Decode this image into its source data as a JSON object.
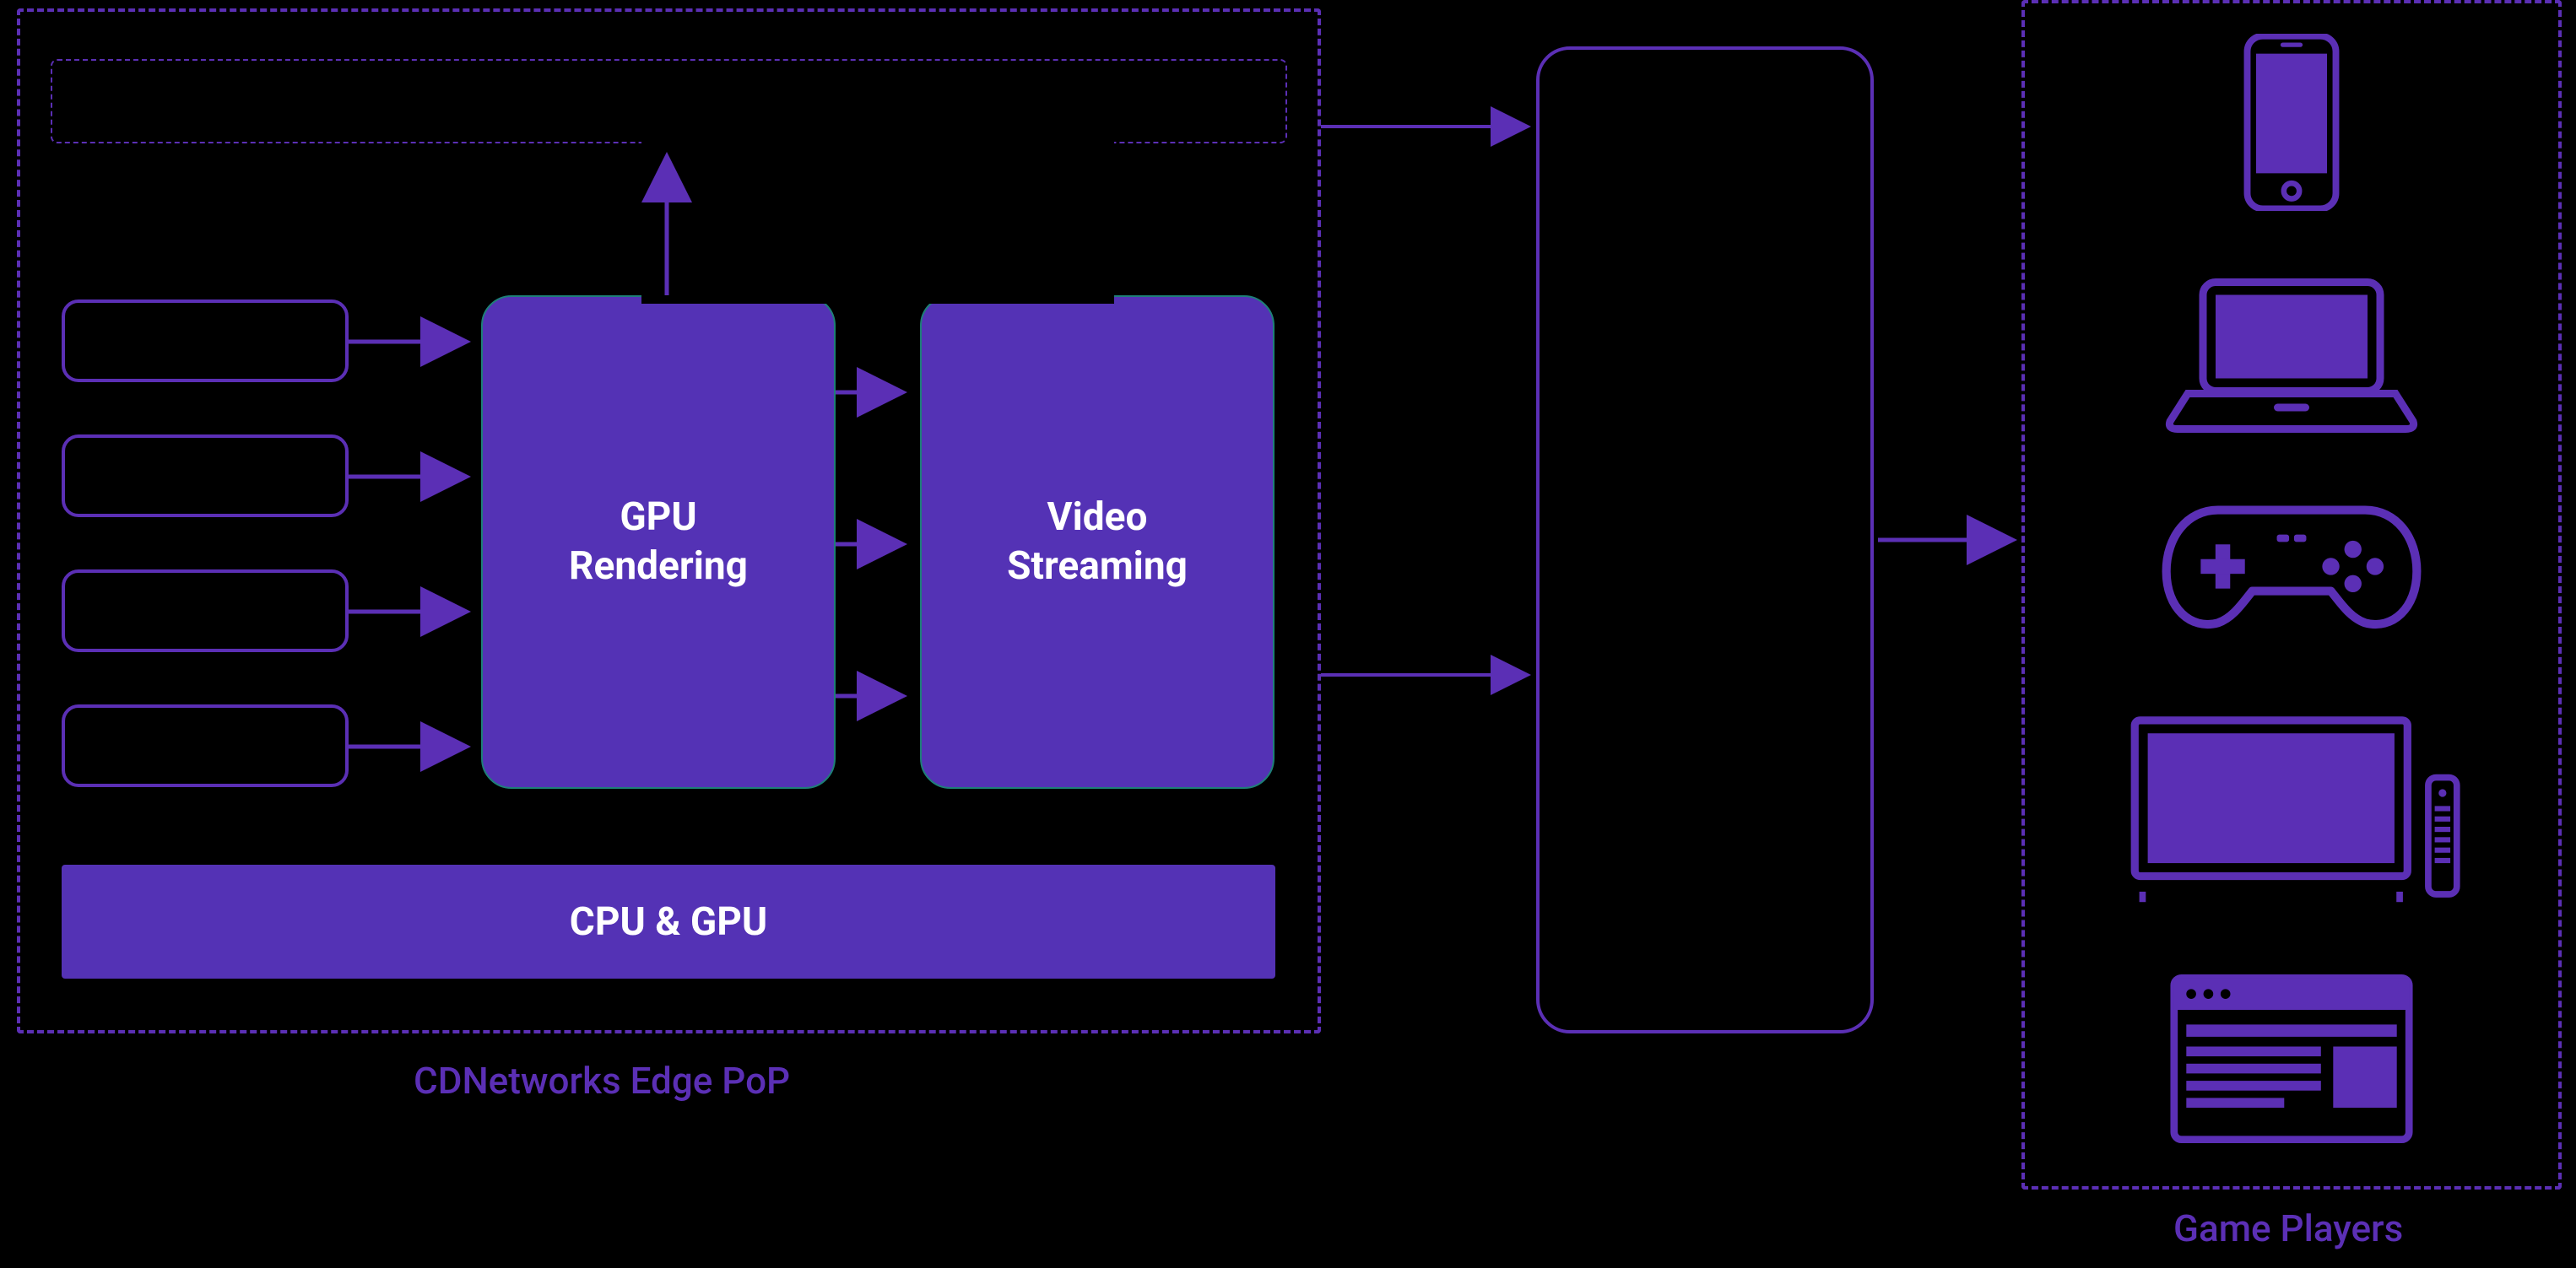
{
  "diagram": {
    "edge_pop_label": "CDNetworks Edge PoP",
    "game_players_label": "Game Players",
    "blocks": {
      "gpu_rendering": "GPU\nRendering",
      "video_streaming": "Video\nStreaming",
      "cpu_gpu": "CPU & GPU"
    },
    "devices": [
      "smartphone-icon",
      "laptop-icon",
      "game-controller-icon",
      "tv-icon",
      "browser-window-icon"
    ]
  }
}
